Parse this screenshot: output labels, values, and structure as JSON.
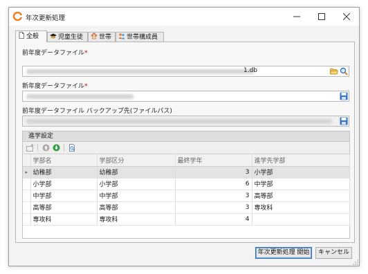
{
  "window": {
    "title": "年次更新処理"
  },
  "tabs": [
    {
      "label": "全般",
      "icon": "document-icon",
      "active": true
    },
    {
      "label": "児童生徒",
      "icon": "student-cap-icon",
      "active": false
    },
    {
      "label": "世帯",
      "icon": "house-icon",
      "active": false
    },
    {
      "label": "世帯構成員",
      "icon": "family-members-icon",
      "active": false
    }
  ],
  "form": {
    "prev_file_label": "前年度データファイル",
    "prev_file_value_suffix": "1.db",
    "new_file_label": "新年度データファイル",
    "backup_label": "前年度データファイル バックアップ先(ファイルパス)",
    "required_mark": "*"
  },
  "grid": {
    "title": "進学設定",
    "columns": [
      "学部名",
      "学部区分",
      "最終学年",
      "進学先学部"
    ],
    "rows": [
      {
        "indicator": "▸",
        "name": "幼稚部",
        "category": "幼稚部",
        "final_year": "3",
        "next": "小学部"
      },
      {
        "indicator": "",
        "name": "小学部",
        "category": "小学部",
        "final_year": "6",
        "next": "中学部"
      },
      {
        "indicator": "",
        "name": "中学部",
        "category": "中学部",
        "final_year": "3",
        "next": "高等部"
      },
      {
        "indicator": "",
        "name": "高等部",
        "category": "高等部",
        "final_year": "3",
        "next": "専攻科"
      },
      {
        "indicator": "",
        "name": "専攻科",
        "category": "専攻科",
        "final_year": "4",
        "next": ""
      }
    ]
  },
  "buttons": {
    "start": "年次更新処理 開始",
    "cancel": "キャンセル"
  },
  "colors": {
    "required": "#d20000",
    "accent_orange": "#f07c1a",
    "save_blue": "#2e74c9"
  }
}
